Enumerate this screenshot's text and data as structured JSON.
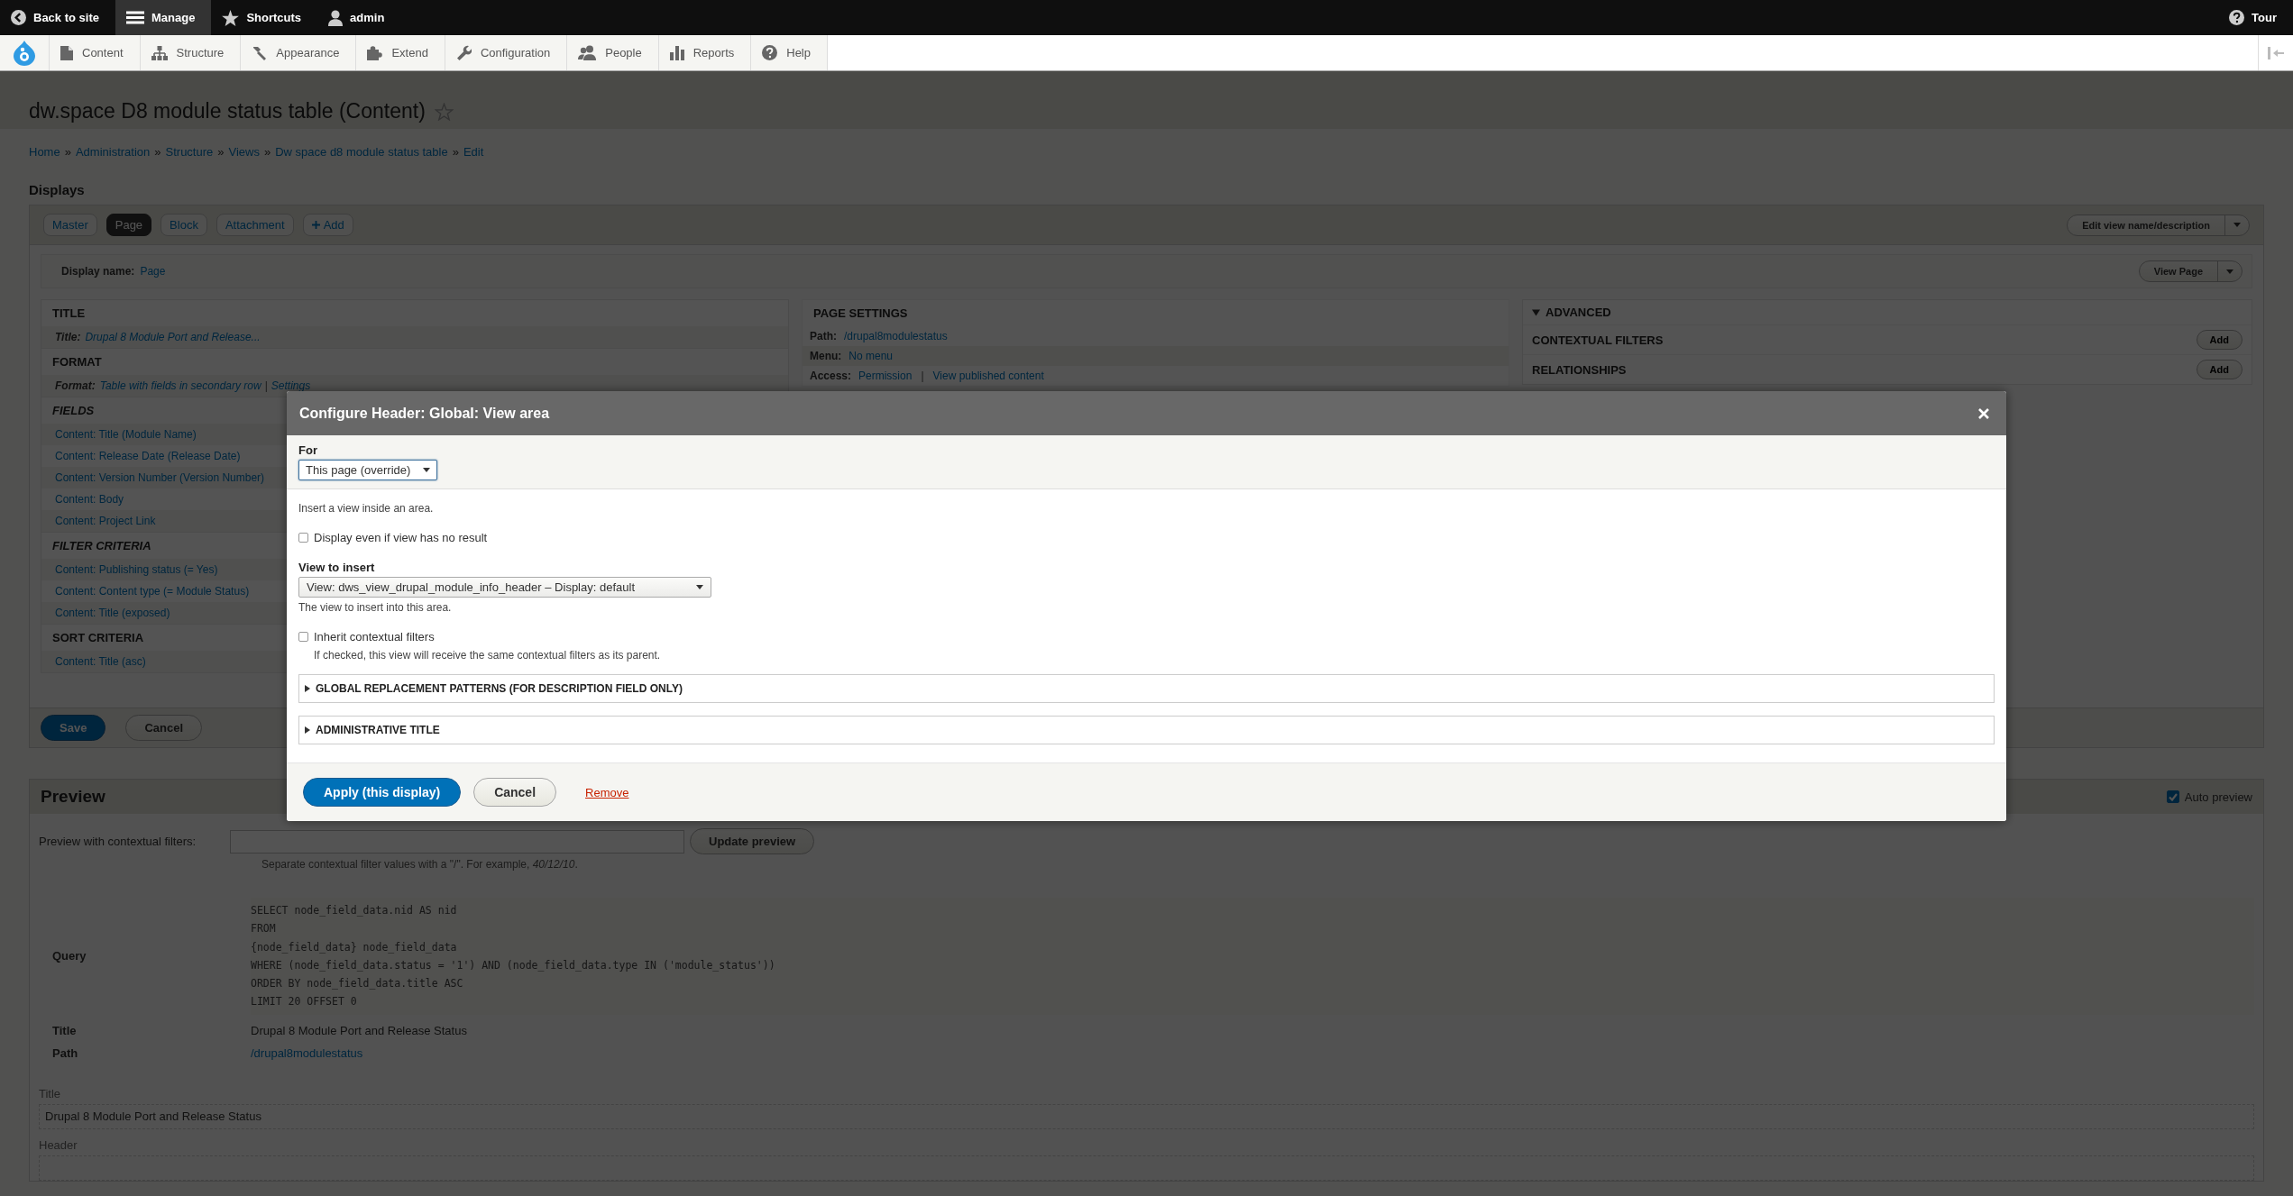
{
  "toolbar": {
    "items": [
      {
        "label": "Back to site",
        "selected": false
      },
      {
        "label": "Manage",
        "selected": true
      },
      {
        "label": "Shortcuts",
        "selected": false
      },
      {
        "label": "admin",
        "selected": false
      }
    ],
    "tour": "Tour",
    "menu": [
      {
        "label": "Content"
      },
      {
        "label": "Structure"
      },
      {
        "label": "Appearance"
      },
      {
        "label": "Extend"
      },
      {
        "label": "Configuration"
      },
      {
        "label": "People"
      },
      {
        "label": "Reports"
      },
      {
        "label": "Help"
      }
    ]
  },
  "page": {
    "title": "dw.space D8 module status table (Content)",
    "breadcrumb_separator": "»",
    "breadcrumb": [
      "Home",
      "Administration",
      "Structure",
      "Views",
      "Dw space d8 module status table",
      "Edit"
    ]
  },
  "displays": {
    "heading": "Displays",
    "tabs": [
      {
        "label": "Master",
        "kind": "tab",
        "selected": false
      },
      {
        "label": "Page",
        "kind": "tab",
        "selected": true
      },
      {
        "label": "Block",
        "kind": "tab",
        "selected": false
      },
      {
        "label": "Attachment",
        "kind": "tab",
        "selected": false
      },
      {
        "label": "Add",
        "kind": "add",
        "selected": false
      }
    ],
    "edit_button": "Edit view name/description",
    "display_name_label": "Display name:",
    "display_name": "Page",
    "view_button": "View Page"
  },
  "left_column": [
    {
      "heading": "TITLE",
      "overridden": false,
      "rows": [
        {
          "label": "Title:",
          "value": "Drupal 8 Module Port and Release..."
        }
      ]
    },
    {
      "heading": "FORMAT",
      "overridden": false,
      "rows": [
        {
          "label": "Format:",
          "value": "Table with fields in secondary row",
          "separator": "|",
          "extra": "Settings"
        }
      ]
    },
    {
      "heading": "FIELDS",
      "overridden": true,
      "rows": [
        {
          "value": "Content: Title (Module Name)"
        },
        {
          "value": "Content: Release Date (Release Date)"
        },
        {
          "value": "Content: Version Number (Version Number)"
        },
        {
          "value": "Content: Body"
        },
        {
          "value": "Content: Project Link"
        }
      ]
    },
    {
      "heading": "FILTER CRITERIA",
      "overridden": true,
      "rows": [
        {
          "value": "Content: Publishing status (= Yes)"
        },
        {
          "value": "Content: Content type (= Module Status)"
        },
        {
          "value": "Content: Title (exposed)"
        }
      ]
    },
    {
      "heading": "SORT CRITERIA",
      "overridden": false,
      "rows": [
        {
          "value": "Content: Title (asc)"
        }
      ]
    }
  ],
  "middle_column": {
    "heading": "PAGE SETTINGS",
    "rows": [
      {
        "label": "Path:",
        "links": [
          "/drupal8modulestatus"
        ]
      },
      {
        "label": "Menu:",
        "links": [
          "No menu"
        ]
      },
      {
        "label": "Access:",
        "links": [
          "Permission",
          "View published content"
        ],
        "separator": "|"
      }
    ]
  },
  "right_column": {
    "advanced": {
      "label": "ADVANCED",
      "expanded": true
    },
    "sections": [
      {
        "heading": "CONTEXTUAL FILTERS",
        "button": "Add"
      },
      {
        "heading": "RELATIONSHIPS",
        "button": "Add"
      }
    ]
  },
  "actions": [
    {
      "label": "Save",
      "kind": "primary"
    },
    {
      "label": "Cancel",
      "kind": "default"
    }
  ],
  "preview": {
    "heading": "Preview",
    "auto_preview": {
      "label": "Auto preview",
      "checked": true
    },
    "filters_label": "Preview with contextual filters:",
    "update_button": "Update preview",
    "hint": "Separate contextual filter values with a \"/\". For example, *40/12/10*.",
    "info": [
      {
        "label": "Query",
        "kind": "code",
        "lines": [
          "SELECT node_field_data.nid AS nid",
          "FROM",
          "{node_field_data} node_field_data",
          "WHERE (node_field_data.status = '1') AND (node_field_data.type IN ('module_status'))",
          "ORDER BY node_field_data.title ASC",
          "LIMIT 20 OFFSET 0"
        ]
      },
      {
        "label": "Title",
        "kind": "text",
        "value": "Drupal 8 Module Port and Release Status"
      },
      {
        "label": "Path",
        "kind": "link",
        "value": "/drupal8modulestatus"
      }
    ],
    "output": [
      {
        "label": "Title",
        "value": "Drupal 8 Module Port and Release Status"
      },
      {
        "label": "Header"
      }
    ]
  },
  "modal": {
    "title": "Configure Header: Global: View area",
    "for_label": "For",
    "for_value": "This page (override)",
    "intro": "Insert a view inside an area.",
    "fields": [
      {
        "kind": "checkbox",
        "label": "Display even if view has no result",
        "checked": false
      },
      {
        "kind": "select",
        "label": "View to insert",
        "value": "View: dws_view_drupal_module_info_header – Display: default",
        "description": "The view to insert into this area."
      },
      {
        "kind": "checkbox",
        "label": "Inherit contextual filters",
        "checked": false,
        "description": "If checked, this view will receive the same contextual filters as its parent."
      },
      {
        "kind": "details",
        "label": "GLOBAL REPLACEMENT PATTERNS (FOR DESCRIPTION FIELD ONLY)",
        "expanded": false
      },
      {
        "kind": "details",
        "label": "ADMINISTRATIVE TITLE",
        "expanded": false
      }
    ],
    "buttons": [
      {
        "label": "Apply (this display)",
        "kind": "primary"
      },
      {
        "label": "Cancel",
        "kind": "default"
      },
      {
        "label": "Remove",
        "kind": "link"
      }
    ]
  }
}
